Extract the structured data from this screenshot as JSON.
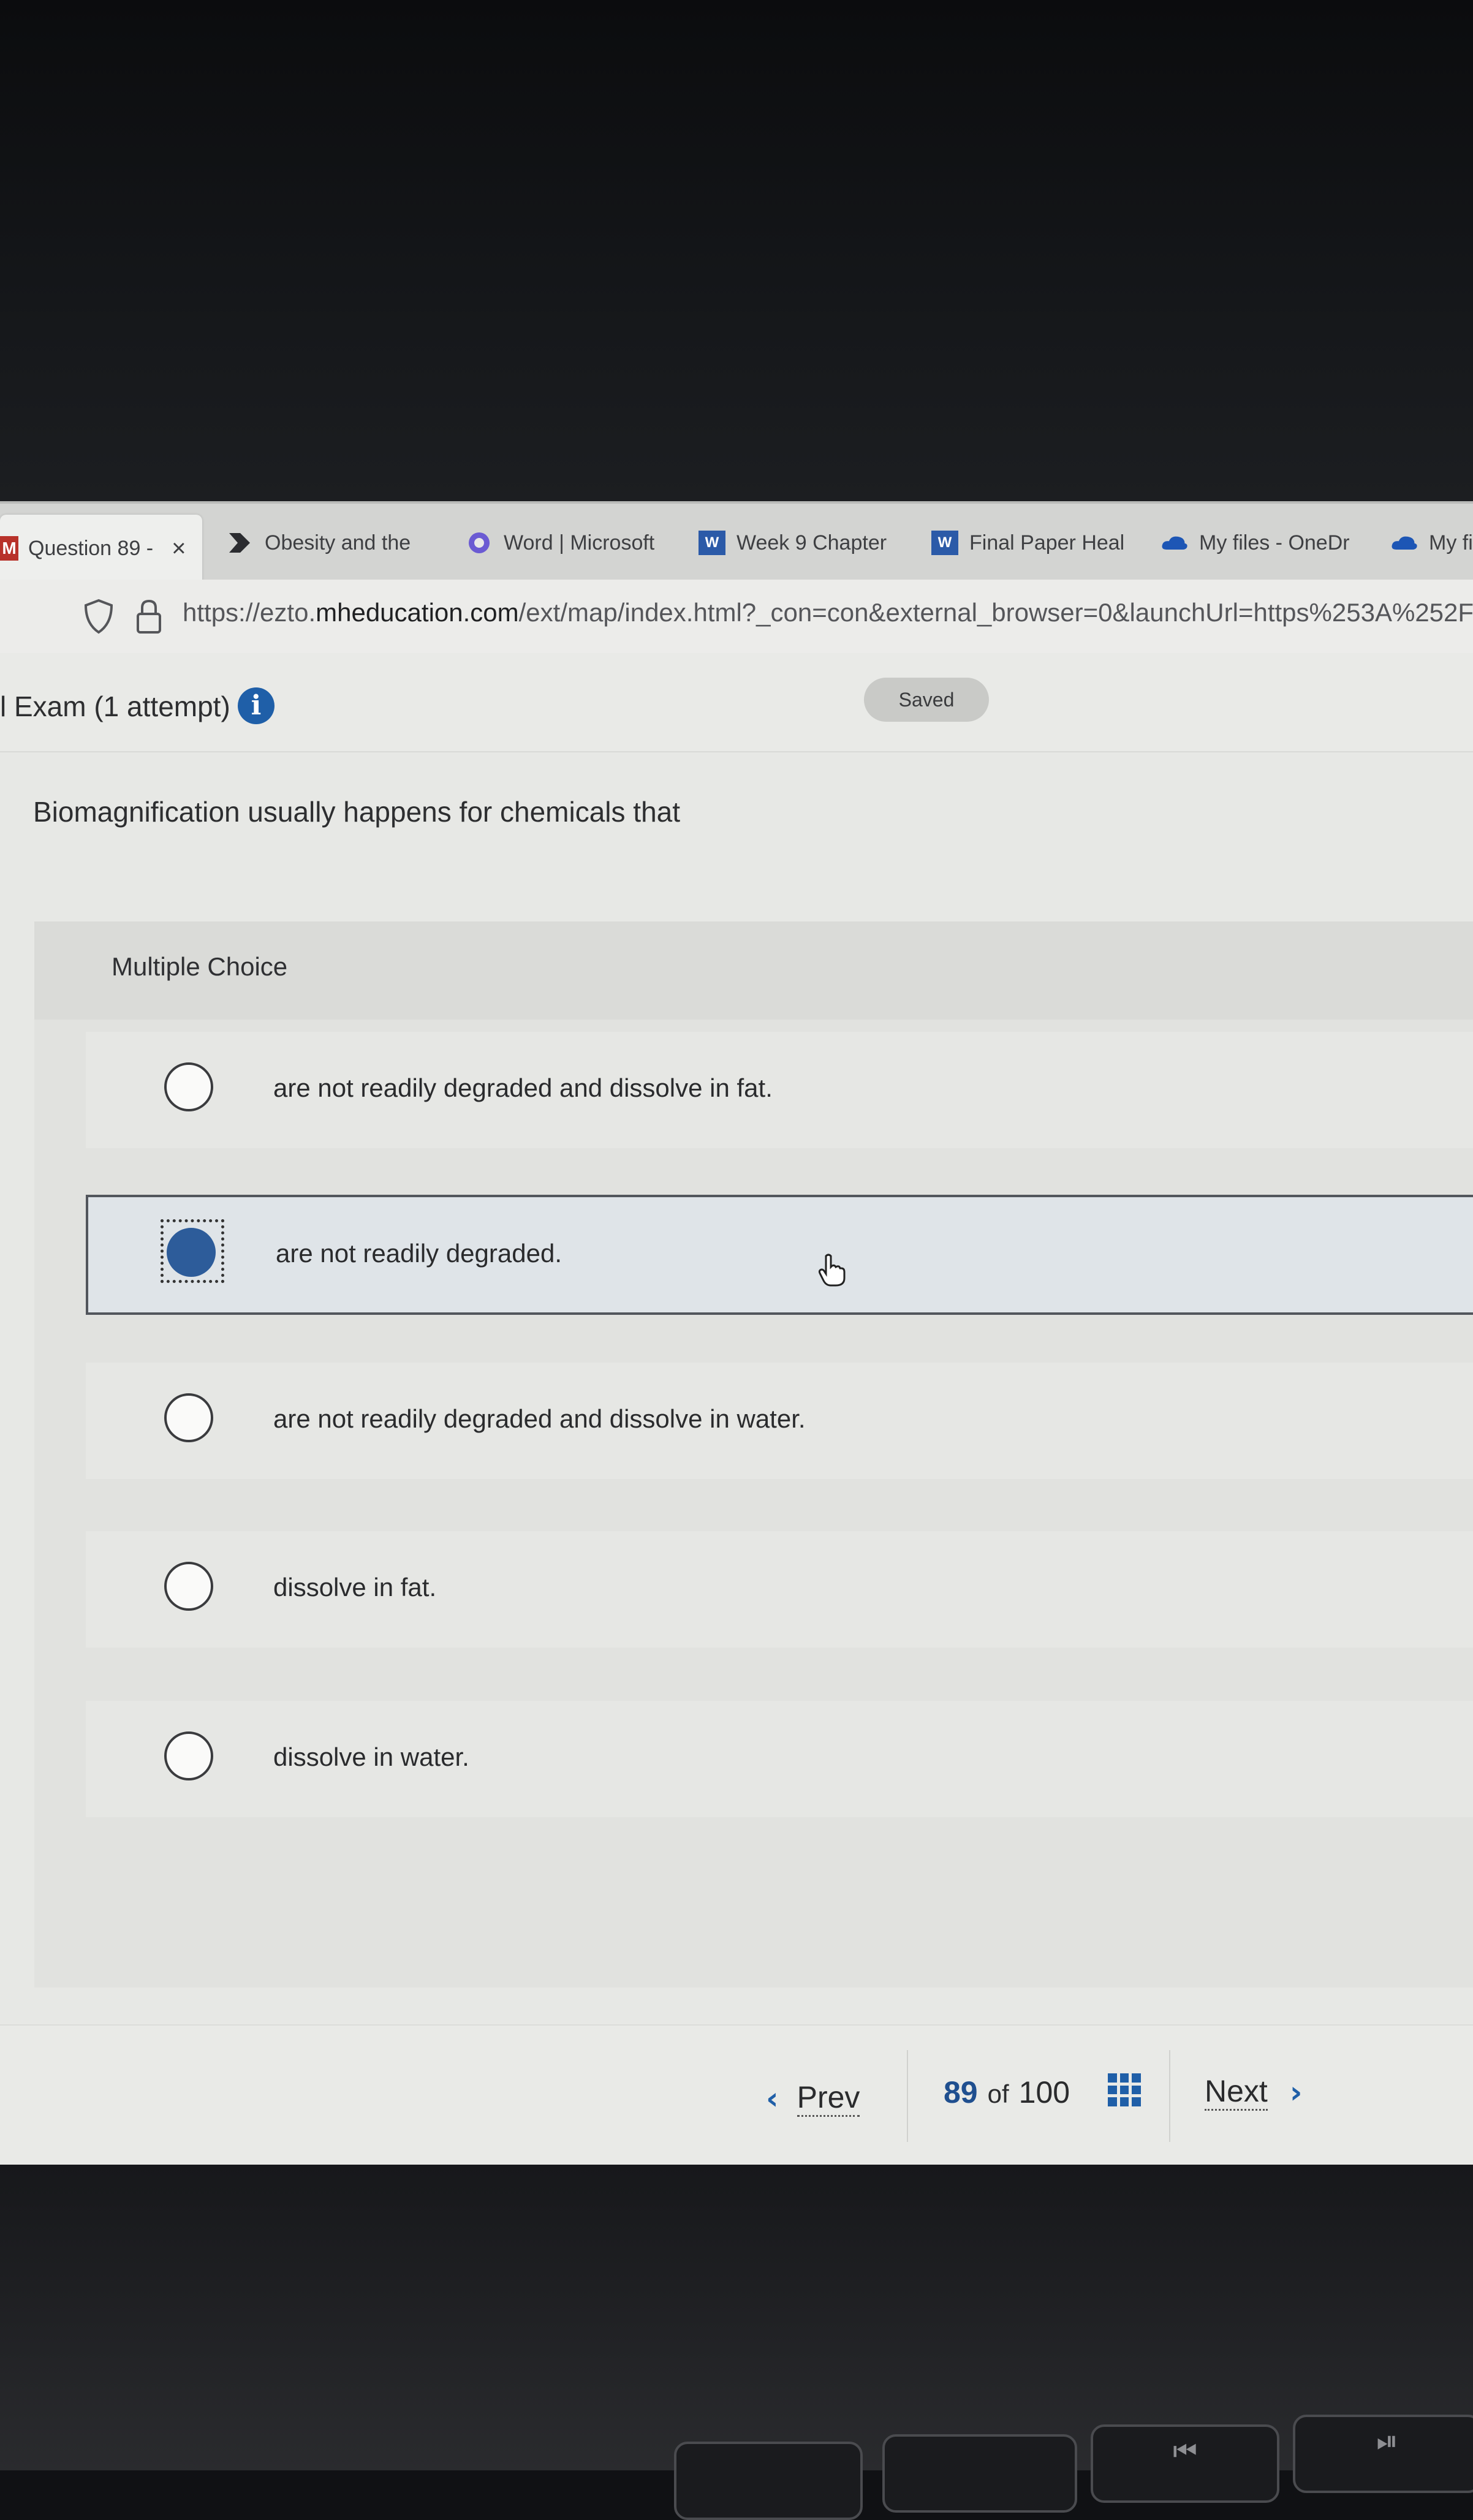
{
  "browser": {
    "tabs": [
      {
        "label": "Question 89 -",
        "close": "×",
        "active": true,
        "icon": "mcgraw-hill-icon"
      },
      {
        "label": "Obesity and the",
        "icon": "play-arrow-icon"
      },
      {
        "label": "Word | Microsoft",
        "icon": "copilot-icon"
      },
      {
        "label": "Week 9 Chapter",
        "icon": "word-doc-icon"
      },
      {
        "label": "Final Paper Heal",
        "icon": "word-doc-icon"
      },
      {
        "label": "My files - OneDr",
        "icon": "onedrive-cloud-icon"
      },
      {
        "label": "My fi",
        "icon": "onedrive-cloud-icon"
      }
    ],
    "url_prefix": "https://ezto.",
    "url_domain": "mheducation.com",
    "url_rest": "/ext/map/index.html?_con=con&external_browser=0&launchUrl=https%253A%252F"
  },
  "exam": {
    "title": "l Exam (1 attempt)",
    "info_glyph": "i",
    "saved_label": "Saved"
  },
  "question": {
    "text": "Biomagnification usually happens for chemicals that",
    "type_label": "Multiple Choice",
    "options": [
      {
        "text": "are not readily degraded and dissolve in fat.",
        "selected": false
      },
      {
        "text": "are not readily degraded.",
        "selected": true
      },
      {
        "text": "are not readily degraded and dissolve in water.",
        "selected": false
      },
      {
        "text": "dissolve in fat.",
        "selected": false
      },
      {
        "text": "dissolve in water.",
        "selected": false
      }
    ]
  },
  "nav": {
    "prev_label": "Prev",
    "next_label": "Next",
    "current": "89",
    "of_label": "of",
    "total": "100"
  },
  "keyboard": {
    "keys": [
      "",
      "",
      "⏮",
      "⏯"
    ]
  },
  "colors": {
    "accent_blue": "#1f5fa8",
    "selected_fill": "#2d5c9a"
  }
}
